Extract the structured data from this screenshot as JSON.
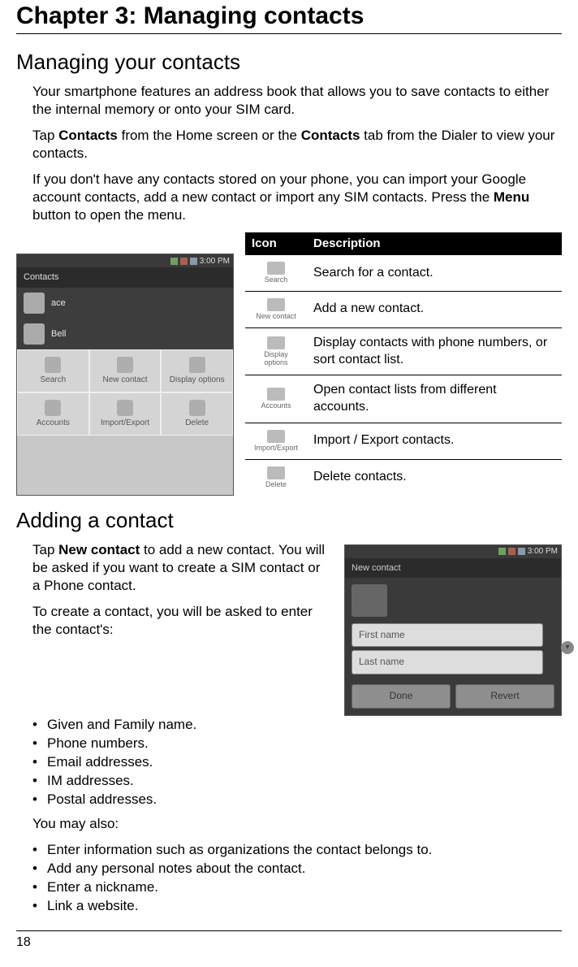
{
  "chapter_title": "Chapter 3: Managing contacts",
  "section1": {
    "heading": "Managing your contacts",
    "p1": "Your smartphone features an address book that allows you to save contacts to either the internal memory or onto your SIM card.",
    "p2a": "Tap ",
    "p2b": "Contacts",
    "p2c": " from the Home screen or the ",
    "p2d": "Contacts",
    "p2e": " tab from the Dialer to view your contacts.",
    "p3a": "If you don't have any contacts stored on your phone, you can import your Google account contacts, add a new contact or import any SIM contacts. Press the ",
    "p3b": "Menu",
    "p3c": " button to open the menu."
  },
  "table": {
    "head_icon": "Icon",
    "head_desc": "Description",
    "rows": [
      {
        "label": "Search",
        "desc": "Search for a contact."
      },
      {
        "label": "New contact",
        "desc": "Add a new contact."
      },
      {
        "label": "Display options",
        "desc": "Display contacts with phone numbers, or sort contact list."
      },
      {
        "label": "Accounts",
        "desc": "Open contact lists from different accounts."
      },
      {
        "label": "Import/Export",
        "desc": "Import / Export contacts."
      },
      {
        "label": "Delete",
        "desc": "Delete contacts."
      }
    ]
  },
  "shot1": {
    "time": "3:00 PM",
    "title": "Contacts",
    "items": [
      "ace",
      "Bell"
    ],
    "menu": [
      "Search",
      "New contact",
      "Display options",
      "Accounts",
      "Import/Export",
      "Delete"
    ]
  },
  "section2": {
    "heading": "Adding a contact",
    "p1a": "Tap ",
    "p1b": "New contact",
    "p1c": " to add a new contact. You will be asked if you want to create a SIM contact or a Phone contact.",
    "p2": "To create a contact, you will be asked to enter the contact's:",
    "list1": [
      "Given and Family name.",
      "Phone numbers.",
      "Email addresses.",
      "IM addresses.",
      "Postal addresses."
    ],
    "p3": "You may also:",
    "list2": [
      "Enter information such as organizations the contact belongs to.",
      "Add any personal notes about the contact.",
      "Enter a nickname.",
      "Link a website."
    ]
  },
  "shot2": {
    "time": "3:00 PM",
    "title": "New contact",
    "first": "First name",
    "last": "Last name",
    "done": "Done",
    "revert": "Revert"
  },
  "page_number": "18"
}
